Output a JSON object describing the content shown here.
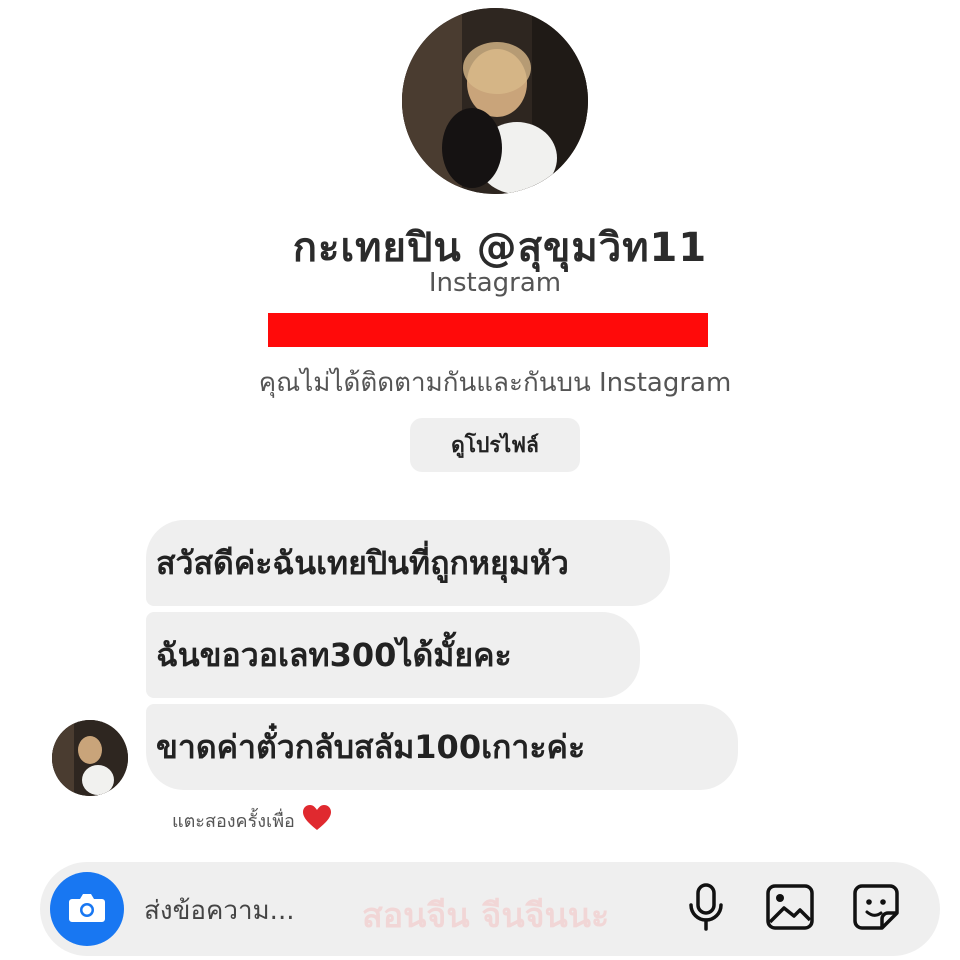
{
  "profile": {
    "name": "กะเทยปิน @สุขุมวิท11",
    "platform": "Instagram",
    "follow_status": "คุณไม่ได้ติดตามกันและกันบน Instagram",
    "view_profile_label": "ดูโปรไฟล์"
  },
  "messages": [
    {
      "text": "สวัสดีค่ะฉันเทยปินที่ถูกหยุมหัว"
    },
    {
      "text": "ฉันขอวอเลท300ได้มั้ยคะ"
    },
    {
      "text": "ขาดค่าตั๋วกลับสลัม100เกาะค่ะ"
    }
  ],
  "reaction_hint": "แตะสองครั้งเพื่อ",
  "composer": {
    "placeholder": "ส่งข้อความ...",
    "watermark": "สอนจีน จีนจีนนะ"
  },
  "colors": {
    "redact": "#ff0a0a",
    "camera": "#1877f2",
    "bubble": "#efefef",
    "heart": "#e0292f"
  },
  "icons": [
    "camera-icon",
    "microphone-icon",
    "gallery-icon",
    "sticker-icon",
    "heart-icon"
  ]
}
